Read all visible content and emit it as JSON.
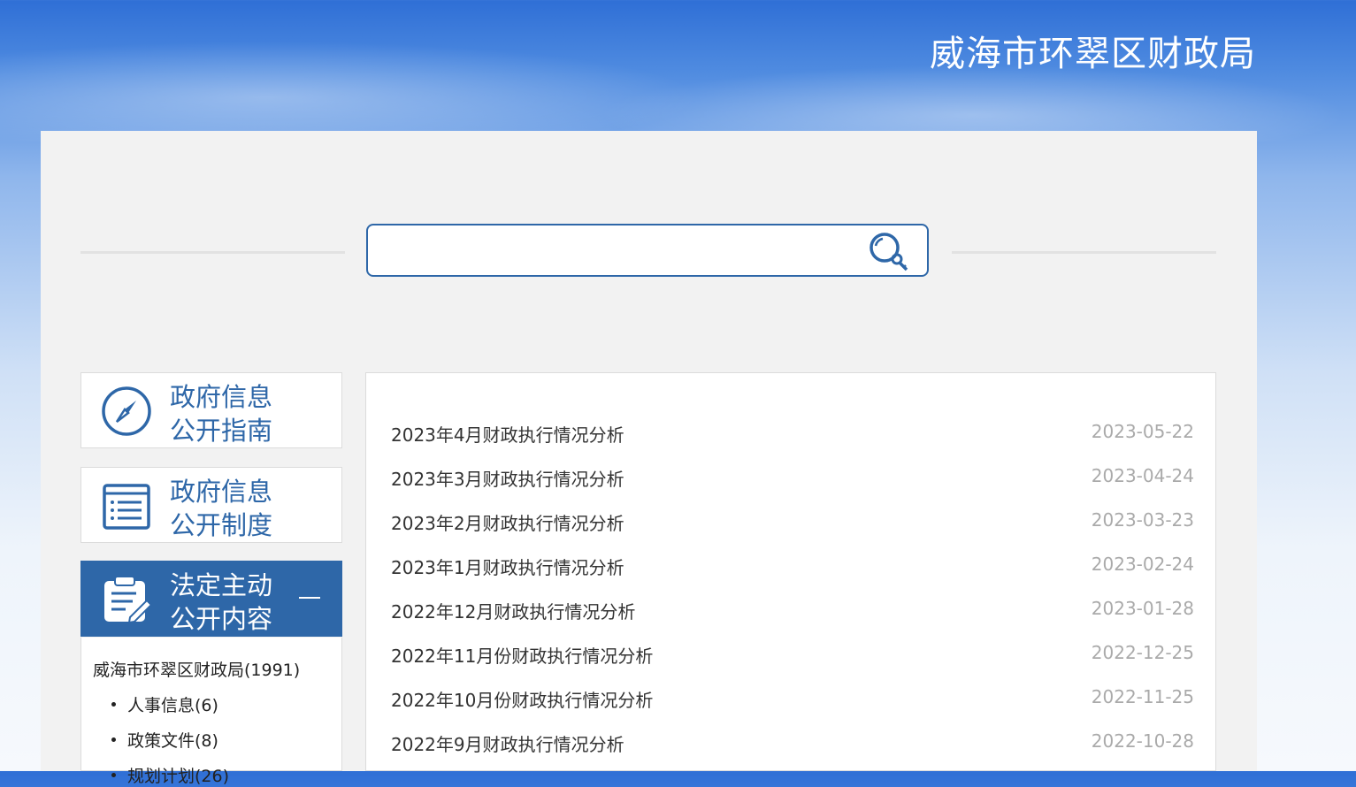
{
  "header": {
    "title": "威海市环翠区财政局"
  },
  "search": {
    "value": "",
    "placeholder": ""
  },
  "sidebar": {
    "cards": [
      {
        "line1": "政府信息",
        "line2": "公开指南",
        "icon": "compass-icon"
      },
      {
        "line1": "政府信息",
        "line2": "公开制度",
        "icon": "list-document-icon"
      },
      {
        "line1": "法定主动",
        "line2": "公开内容",
        "icon": "clipboard-edit-icon",
        "active": true,
        "toggle": "—"
      }
    ],
    "tree": {
      "root": "威海市环翠区财政局(1991)",
      "items": [
        "人事信息(6)",
        "政策文件(8)",
        "规划计划(26)"
      ]
    }
  },
  "list": {
    "items": [
      {
        "title": "2023年4月财政执行情况分析",
        "date": "2023-05-22"
      },
      {
        "title": "2023年3月财政执行情况分析",
        "date": "2023-04-24"
      },
      {
        "title": "2023年2月财政执行情况分析",
        "date": "2023-03-23"
      },
      {
        "title": "2023年1月财政执行情况分析",
        "date": "2023-02-24"
      },
      {
        "title": "2022年12月财政执行情况分析",
        "date": "2023-01-28"
      },
      {
        "title": "2022年11月份财政执行情况分析",
        "date": "2022-12-25"
      },
      {
        "title": "2022年10月份财政执行情况分析",
        "date": "2022-11-25"
      },
      {
        "title": "2022年9月财政执行情况分析",
        "date": "2022-10-28"
      }
    ]
  },
  "colors": {
    "primary": "#2e67a8",
    "date": "#aaaaaa",
    "panel": "#f2f2f2"
  }
}
